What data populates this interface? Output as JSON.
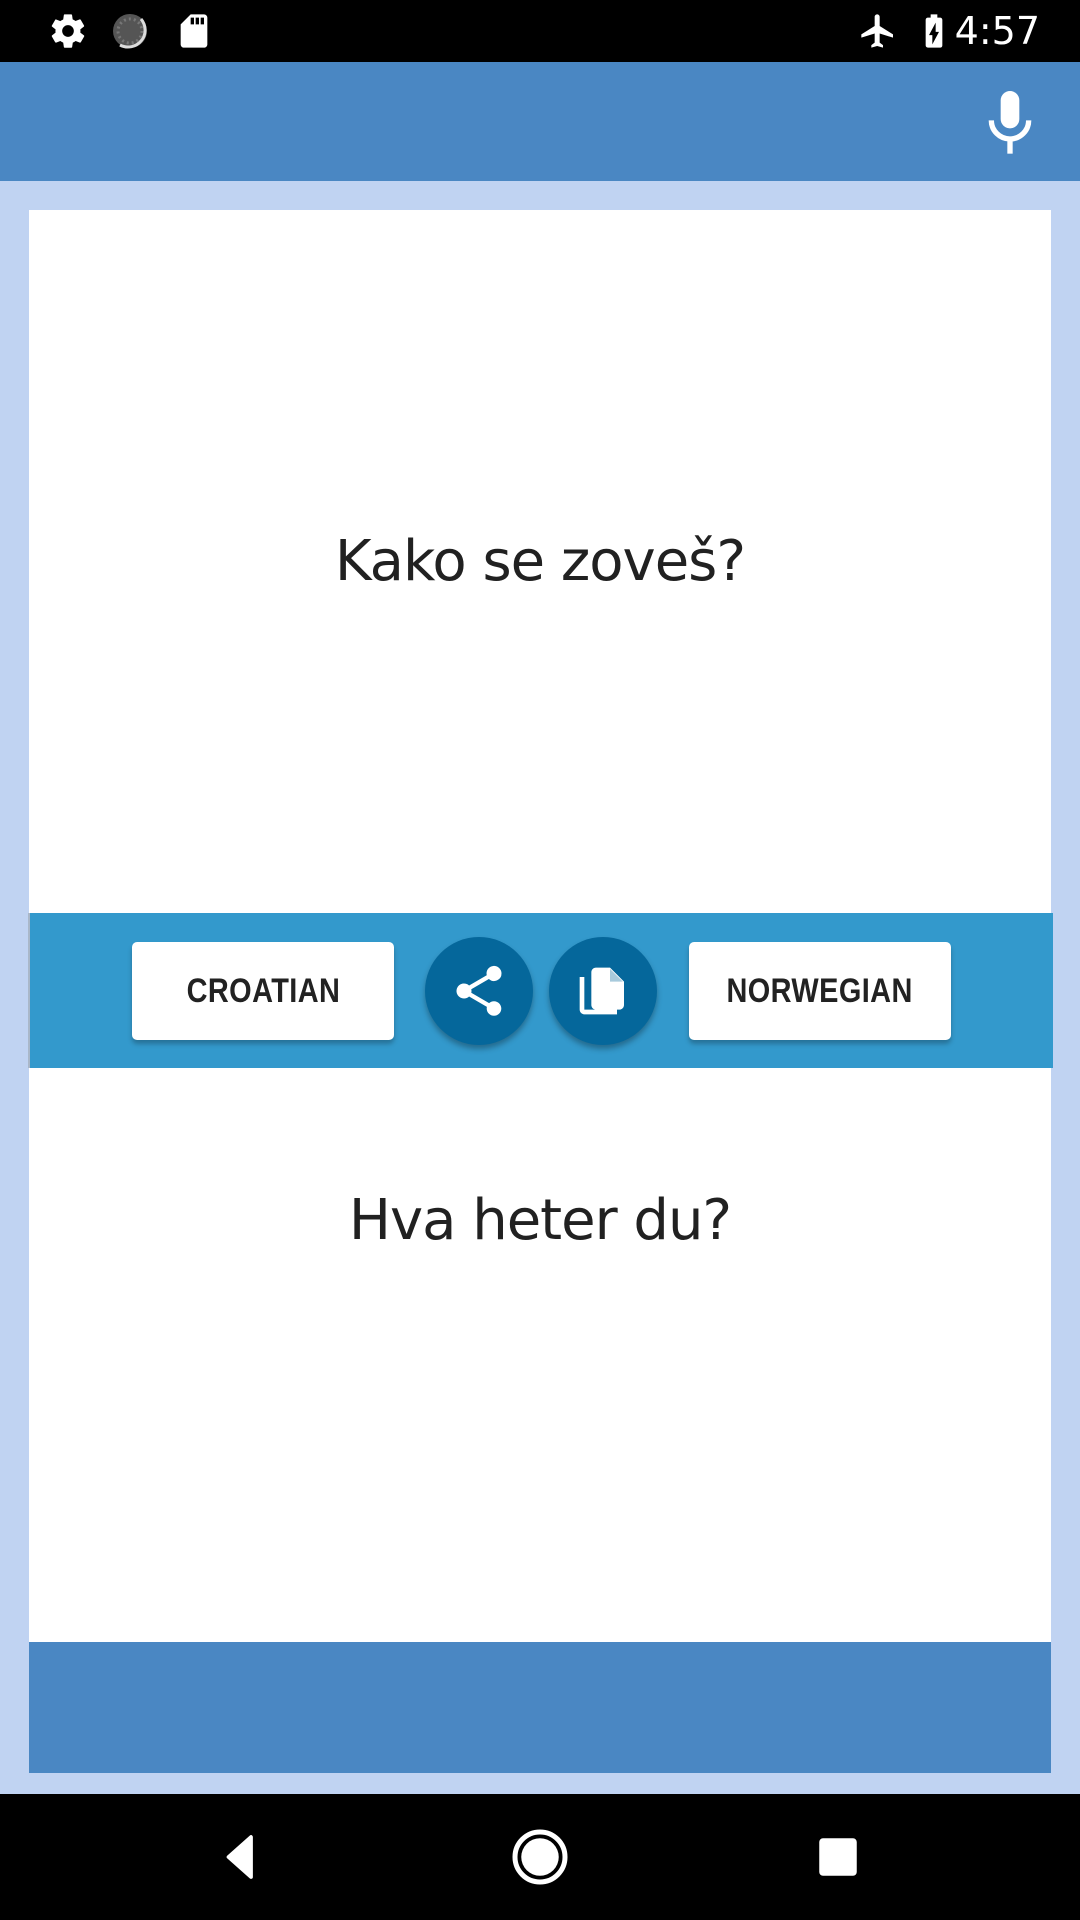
{
  "status_bar": {
    "left_icons": [
      "settings-icon",
      "sync-progress-icon",
      "sd-card-icon"
    ],
    "right_icons": [
      "airplane-mode-icon",
      "battery-charging-icon"
    ],
    "time": "4:57"
  },
  "app_bar": {
    "action_icon": "microphone-icon",
    "colors": {
      "app_bar": "#4a87c3",
      "background": "#c0d3f2"
    }
  },
  "source": {
    "text": "Kako se zoveš?"
  },
  "toolbar": {
    "source_language": "CROATIAN",
    "target_language": "NORWEGIAN",
    "share_icon": "share-icon",
    "copy_icon": "copy-icon",
    "colors": {
      "bar": "#3399cc",
      "circle": "#05679b"
    }
  },
  "translation": {
    "text": "Hva heter du?"
  },
  "nav_bar": {
    "buttons": [
      "back-icon",
      "home-icon",
      "recents-icon"
    ]
  }
}
